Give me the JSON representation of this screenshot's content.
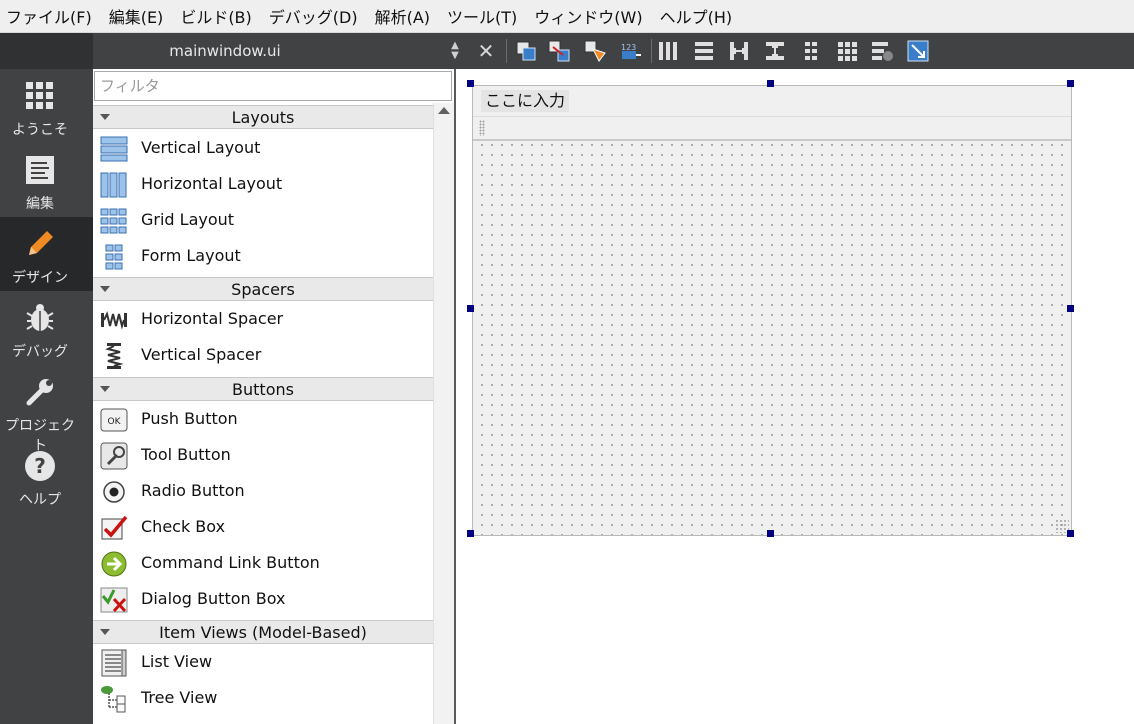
{
  "menubar": {
    "items": [
      "ファイル(F)",
      "編集(E)",
      "ビルド(B)",
      "デバッグ(D)",
      "解析(A)",
      "ツール(T)",
      "ウィンドウ(W)",
      "ヘルプ(H)"
    ]
  },
  "toolbar": {
    "file_title": "mainwindow.ui",
    "close_icon": "close-icon"
  },
  "modes": [
    {
      "label": "ようこそ",
      "icon": "welcome-grid-icon"
    },
    {
      "label": "編集",
      "icon": "edit-document-icon"
    },
    {
      "label": "デザイン",
      "icon": "design-pencil-icon"
    },
    {
      "label": "デバッグ",
      "icon": "debug-bug-icon"
    },
    {
      "label": "プロジェクト",
      "icon": "project-wrench-icon"
    },
    {
      "label": "ヘルプ",
      "icon": "help-question-icon"
    }
  ],
  "widgetbox": {
    "filter_placeholder": "フィルタ",
    "categories": [
      {
        "title": "Layouts",
        "items": [
          "Vertical Layout",
          "Horizontal Layout",
          "Grid Layout",
          "Form Layout"
        ]
      },
      {
        "title": "Spacers",
        "items": [
          "Horizontal Spacer",
          "Vertical Spacer"
        ]
      },
      {
        "title": "Buttons",
        "items": [
          "Push Button",
          "Tool Button",
          "Radio Button",
          "Check Box",
          "Command Link Button",
          "Dialog Button Box"
        ]
      },
      {
        "title": "Item Views (Model-Based)",
        "items": [
          "List View",
          "Tree View"
        ]
      }
    ]
  },
  "form": {
    "menu_placeholder": "ここに入力"
  },
  "colors": {
    "sidebar_bg": "#404244",
    "active_mode_bg": "#262829",
    "selection_handle": "#000080",
    "form_bg": "#f0f0f0"
  }
}
